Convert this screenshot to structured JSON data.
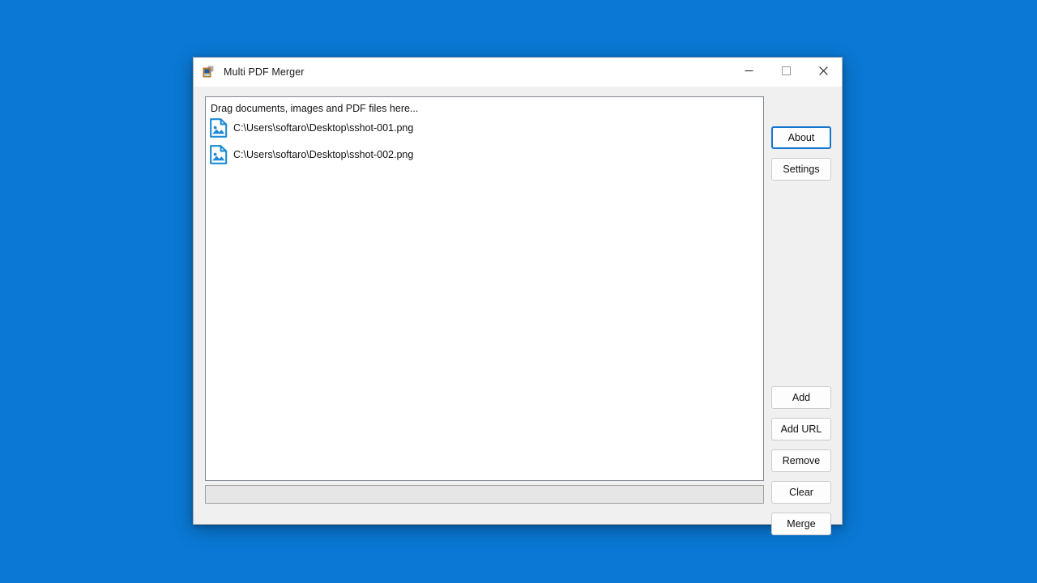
{
  "window": {
    "title": "Multi PDF Merger",
    "icon": "app-icon",
    "controls": {
      "minimize_label": "—",
      "maximize_label": "☐",
      "close_label": "✕"
    }
  },
  "file_list": {
    "drop_hint": "Drag documents, images and PDF files here...",
    "items": [
      {
        "path": "C:\\Users\\softaro\\Desktop\\sshot-001.png",
        "icon": "image-file-icon"
      },
      {
        "path": "C:\\Users\\softaro\\Desktop\\sshot-002.png",
        "icon": "image-file-icon"
      }
    ]
  },
  "progress": {
    "value": 0,
    "value_text": ""
  },
  "buttons": {
    "about": "About",
    "settings": "Settings",
    "add": "Add",
    "add_url": "Add URL",
    "remove": "Remove",
    "clear": "Clear",
    "merge": "Merge"
  },
  "colors": {
    "desktop": "#0a78d4",
    "window_chrome": "#f0f0f0",
    "titlebar": "#ffffff",
    "focus_outline": "#1477d1",
    "file_icon": "#1c8ad4",
    "list_background": "#ffffff",
    "progress_track": "#e6e6e6"
  }
}
